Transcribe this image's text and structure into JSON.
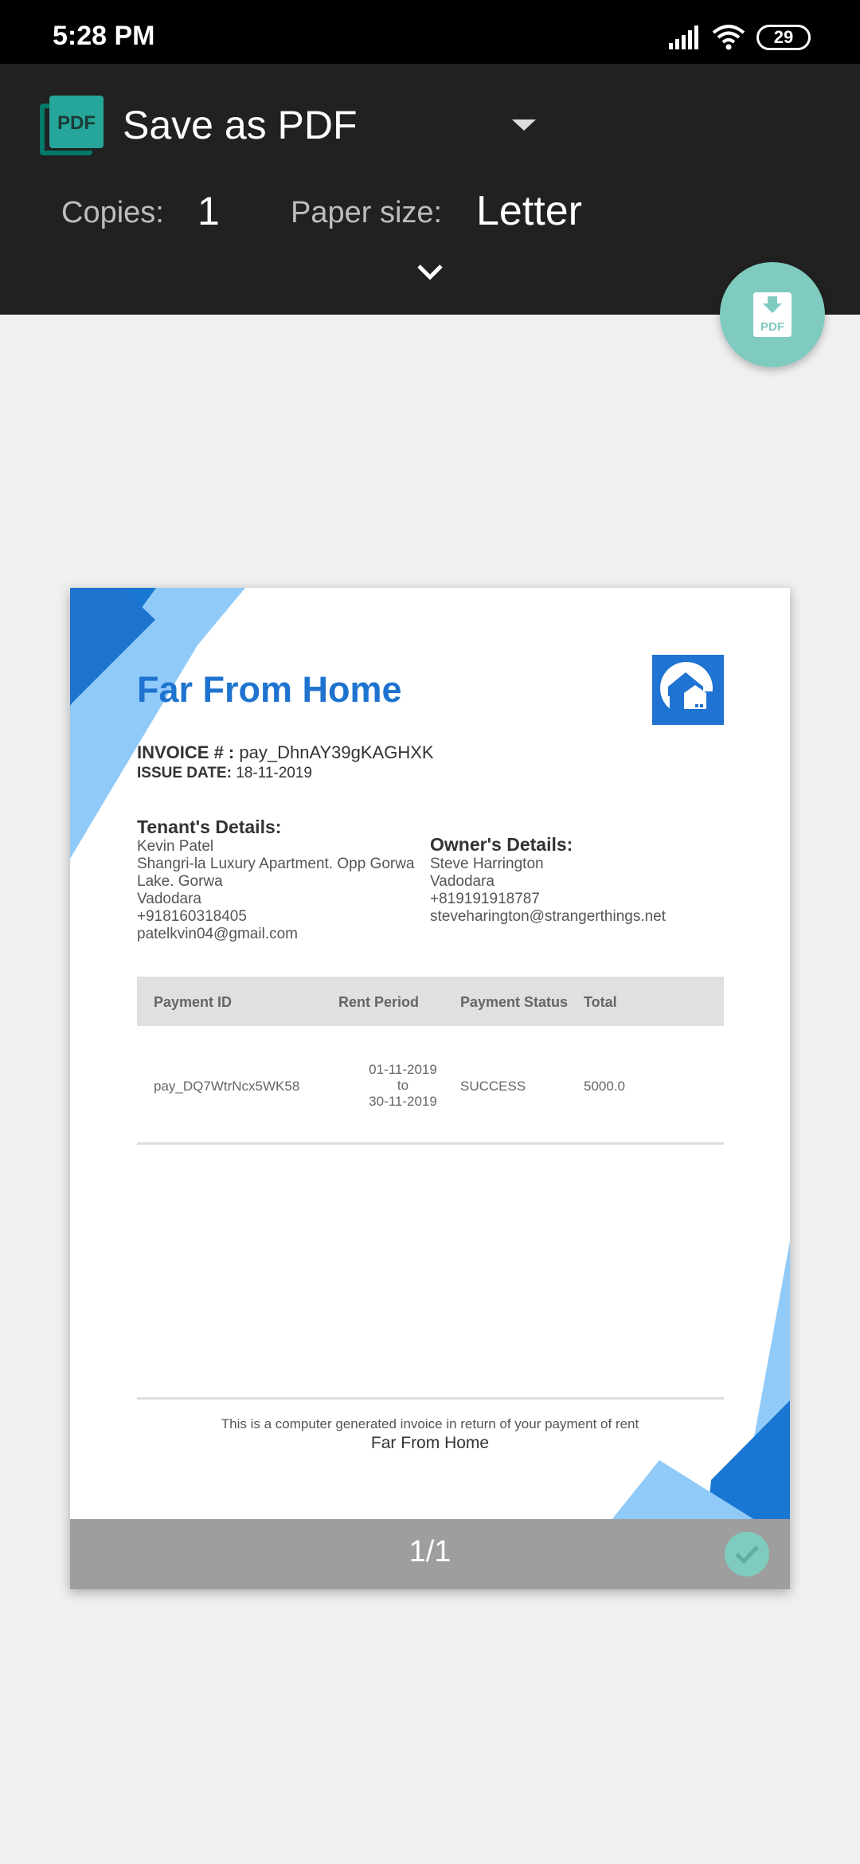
{
  "status_bar": {
    "time": "5:28 PM",
    "battery": "29"
  },
  "header": {
    "printer_name": "Save as PDF",
    "copies_label": "Copies:",
    "copies_value": "1",
    "paper_size_label": "Paper size:",
    "paper_size_value": "Letter",
    "pdf_logo_text": "PDF"
  },
  "fab": {
    "icon": "download-pdf-icon",
    "text": "PDF",
    "color": "#7fcbc0"
  },
  "invoice": {
    "company_name": "Far From Home",
    "invoice_label": "INVOICE # :",
    "invoice_number": "pay_DhnAY39gKAGHXK",
    "issue_label": "ISSUE DATE:",
    "issue_date": "18-11-2019",
    "tenant": {
      "title": "Tenant's Details:",
      "lines": [
        "Kevin Patel",
        "Shangri-la Luxury Apartment. Opp Gorwa",
        "Lake. Gorwa",
        "Vadodara",
        "+918160318405",
        "patelkvin04@gmail.com"
      ]
    },
    "owner": {
      "title": "Owner's Details:",
      "lines": [
        "Steve Harrington",
        "Vadodara",
        "+819191918787",
        "steveharington@strangerthings.net"
      ]
    },
    "table": {
      "headers": [
        "Payment ID",
        "Rent Period",
        "Payment Status",
        "Total"
      ],
      "row": {
        "payment_id": "pay_DQ7WtrNcx5WK58",
        "period_from": "01-11-2019",
        "period_to_word": "to",
        "period_to": "30-11-2019",
        "status": "SUCCESS",
        "total": "5000.0"
      }
    },
    "footer_note": "This is a computer generated invoice in return of your payment of rent",
    "footer_company": "Far From Home"
  },
  "page_footer": {
    "page_number": "1/1"
  },
  "colors": {
    "accent_blue": "#1e73cf",
    "light_blue": "#90caf9",
    "header_bg": "#212121",
    "teal": "#7fcbc0"
  }
}
